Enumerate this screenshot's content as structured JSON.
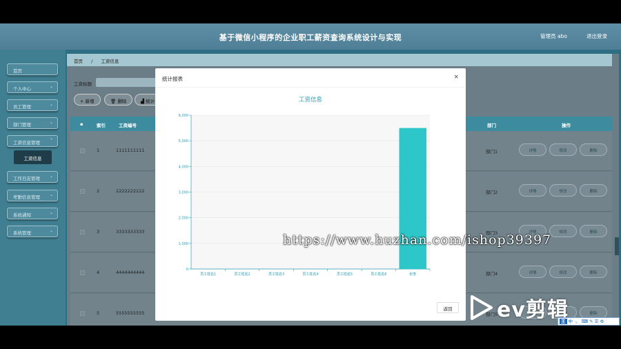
{
  "header": {
    "title": "基于微信小程序的企业职工薪资查询系统设计与实现",
    "admin": "管理员 abo",
    "logout": "退出登录"
  },
  "sidebar": {
    "items": [
      {
        "label": "首页",
        "arrow": false
      },
      {
        "label": "个人中心",
        "arrow": true
      },
      {
        "label": "员工管理",
        "arrow": true
      },
      {
        "label": "部门管理",
        "arrow": true
      },
      {
        "label": "工资信息管理",
        "arrow": true
      },
      {
        "label": "工作日志管理",
        "arrow": true
      },
      {
        "label": "考勤信息管理",
        "arrow": true
      },
      {
        "label": "系统通知",
        "arrow": true
      },
      {
        "label": "系统管理",
        "arrow": true
      }
    ],
    "active_sub": "工资信息"
  },
  "breadcrumb": [
    "首页",
    "工资信息"
  ],
  "filter": {
    "label": "工资标题",
    "placeholder": "工资标题"
  },
  "toolbar": {
    "add": "+ 新增",
    "delete": "删除",
    "stats": "统计"
  },
  "table": {
    "headers": {
      "index": "索引",
      "number": "工资编号",
      "dept": "部门",
      "ops": "操作"
    },
    "rows": [
      {
        "index": "1",
        "number": "1111111111",
        "dept": "部门1"
      },
      {
        "index": "2",
        "number": "2222222222",
        "dept": "部门2"
      },
      {
        "index": "3",
        "number": "3333333333",
        "dept": "部门3"
      },
      {
        "index": "4",
        "number": "4444444444",
        "dept": "部门4"
      },
      {
        "index": "5",
        "number": "5555555555",
        "dept": "部门5"
      }
    ],
    "ops": {
      "detail": "详情",
      "edit": "修改",
      "delete": "删除"
    }
  },
  "modal": {
    "title": "统计报表",
    "close": "×",
    "ok": "返回"
  },
  "chart_data": {
    "type": "bar",
    "title": "工资信息",
    "categories": [
      "员工姓名1",
      "员工姓名2",
      "员工姓名3",
      "员工姓名4",
      "员工姓名5",
      "员工姓名6",
      "张李"
    ],
    "values": [
      0,
      0,
      0,
      0,
      0,
      0,
      5500
    ],
    "yticks": [
      "0",
      "1,000",
      "2,000",
      "3,000",
      "4,000",
      "5,000",
      "6,000"
    ],
    "ylim": [
      0,
      6000
    ],
    "bar_color": "#2ec7c9",
    "grid": true
  },
  "watermark": "https://www.huzhan.com/ishop39397",
  "ev_logo": "ev剪辑",
  "ime": {
    "badge": "王",
    "text": "中 ·。 ⌨ ✎ ☰ ⚙"
  }
}
